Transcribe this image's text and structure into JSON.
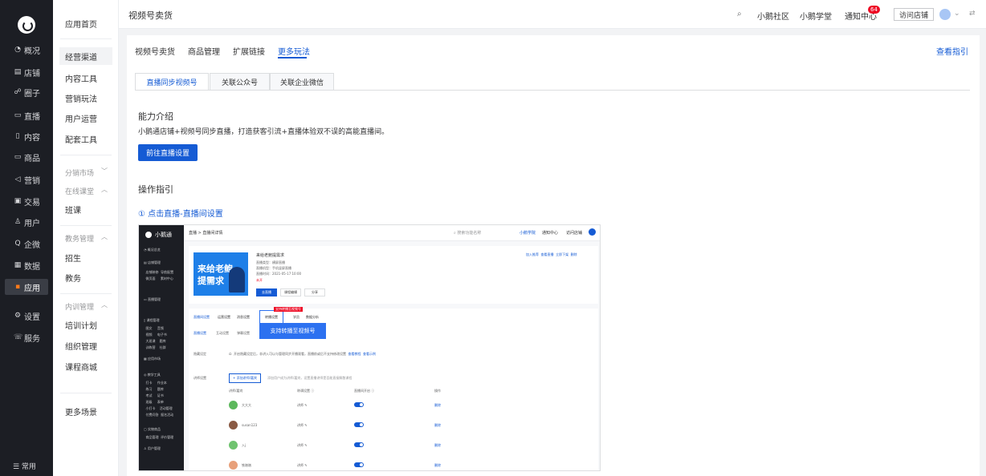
{
  "nav": {
    "items": [
      {
        "label": "概况",
        "icon": "◔"
      },
      {
        "label": "店铺",
        "icon": "▤"
      },
      {
        "label": "圈子",
        "icon": "☍"
      },
      {
        "label": "直播",
        "icon": "▭"
      },
      {
        "label": "内容",
        "icon": "▯"
      },
      {
        "label": "商品",
        "icon": "▭"
      },
      {
        "label": "营销",
        "icon": "◁"
      },
      {
        "label": "交易",
        "icon": "▣"
      },
      {
        "label": "用户",
        "icon": "♙"
      },
      {
        "label": "企微",
        "icon": "Q"
      },
      {
        "label": "数据",
        "icon": "▦"
      },
      {
        "label": "应用",
        "icon": "▪"
      },
      {
        "label": "设置",
        "icon": "⚙"
      },
      {
        "label": "服务",
        "icon": "☏"
      }
    ],
    "bottom": "☰ 常用"
  },
  "side": {
    "home": "应用首页",
    "items": [
      "经营渠道",
      "内容工具",
      "营销玩法",
      "用户运营",
      "配套工具"
    ],
    "groups": [
      "分销市场",
      "在线课堂",
      "教务管理",
      "内训管理"
    ],
    "class": "班课",
    "edu": [
      "招生",
      "教务"
    ],
    "train": [
      "培训计划",
      "组织管理",
      "课程商城"
    ],
    "more": "更多场景"
  },
  "top": {
    "title": "视频号卖货",
    "links": [
      "小鹅社区",
      "小鹅学堂",
      "通知中心"
    ],
    "badge": "64",
    "visit": "访问店铺"
  },
  "tabs": [
    "视频号卖货",
    "商品管理",
    "扩展链接",
    "更多玩法"
  ],
  "guide": "查看指引",
  "subtabs": [
    "直播同步视频号",
    "关联公众号",
    "关联企业微信"
  ],
  "intro": {
    "title": "能力介绍",
    "desc": "小鹅通店铺+视频号同步直播，打造获客引流+直播体验双不误的高能直播间。",
    "button": "前往直播设置"
  },
  "ops": {
    "title": "操作指引",
    "step": "① 点击直播-直播间设置"
  },
  "shot": {
    "logo": "小鹅通",
    "crumb": "直播 > 直播间详情",
    "poster": [
      "来给老鲍",
      "提需求"
    ],
    "name": "来给老鲍提需求",
    "tip": "支持转播至视频号",
    "tabs": [
      "直播间设置",
      "运营设置",
      "消息设置",
      "转播设置",
      "学员",
      "数据分析"
    ],
    "users": [
      "大大大",
      "susan123",
      "入j",
      "铁墩墩"
    ],
    "col": "姓名/昵称"
  }
}
